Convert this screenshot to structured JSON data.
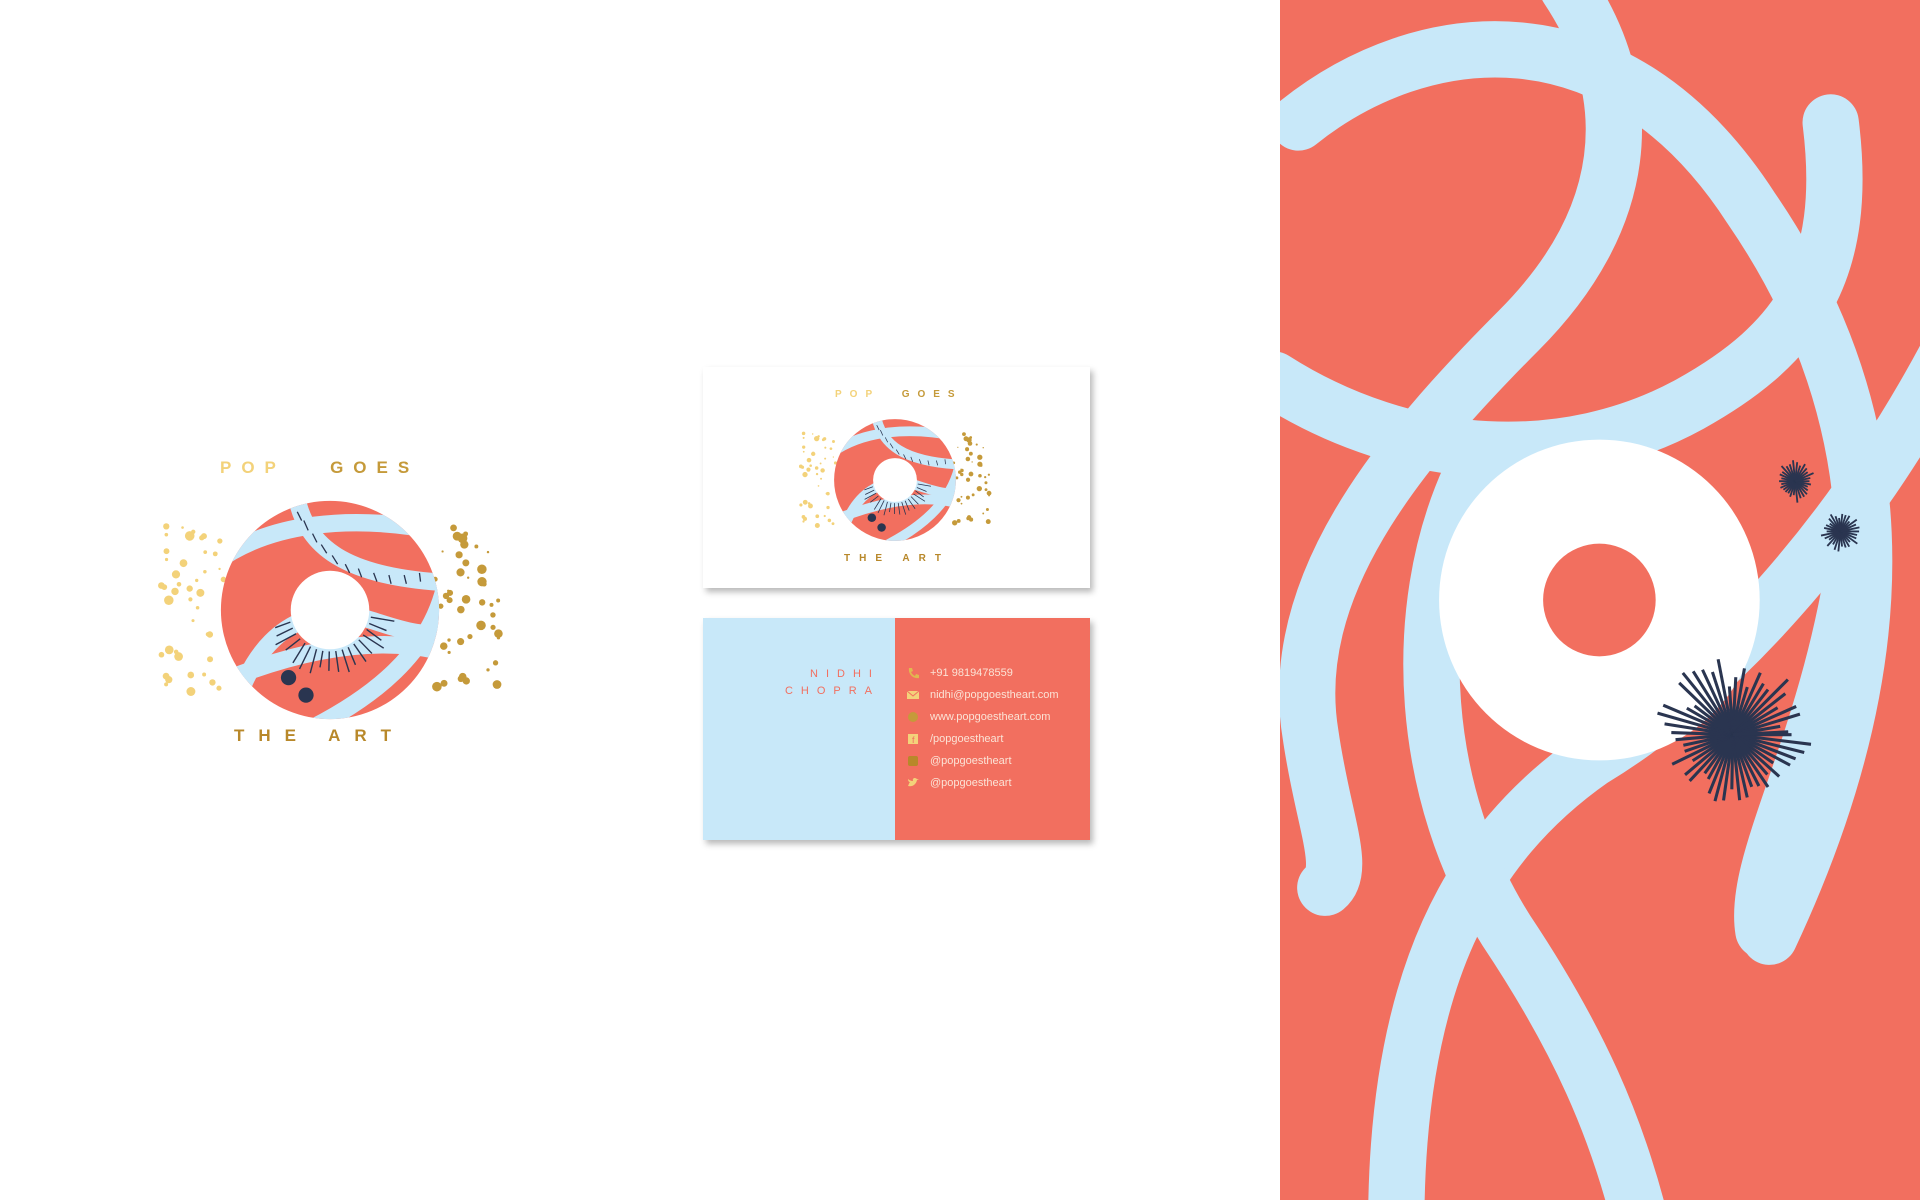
{
  "logo": {
    "line1_a": "POP",
    "line1_b": "GOES",
    "line2": "THE ART"
  },
  "card_front": {
    "line1_a": "POP",
    "line1_b": "GOES",
    "line2": "THE ART"
  },
  "card_back": {
    "first_name": "NIDHI",
    "last_name": "CHOPRA",
    "contacts": [
      {
        "icon": "phone-icon",
        "text": "+91 9819478559"
      },
      {
        "icon": "mail-icon",
        "text": "nidhi@popgoestheart.com"
      },
      {
        "icon": "globe-icon",
        "text": "www.popgoestheart.com"
      },
      {
        "icon": "facebook-icon",
        "text": "/popgoestheart"
      },
      {
        "icon": "instagram-icon",
        "text": "@popgoestheart"
      },
      {
        "icon": "twitter-icon",
        "text": "@popgoestheart"
      }
    ]
  },
  "colors": {
    "coral": "#f26f5f",
    "light_blue": "#c8e8f9",
    "gold": "#e0b84f",
    "navy": "#2a3550"
  }
}
